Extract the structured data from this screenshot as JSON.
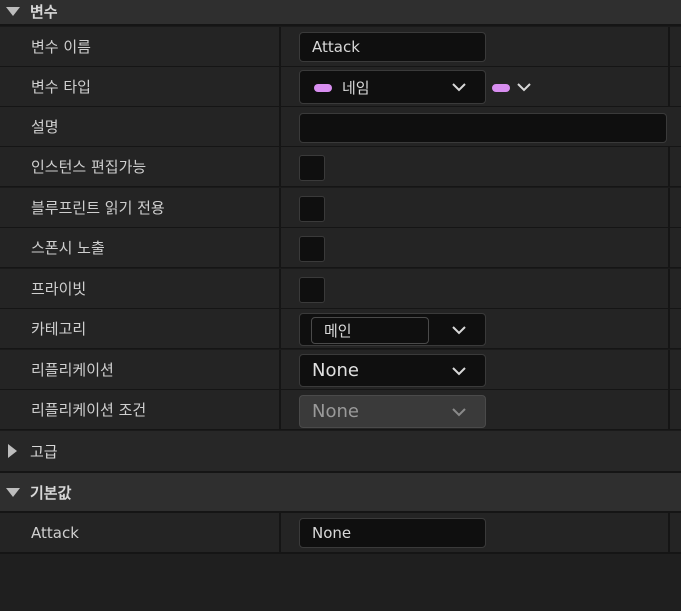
{
  "sections": {
    "variable": {
      "title": "변수"
    },
    "advanced": {
      "title": "고급"
    },
    "default_value": {
      "title": "기본값"
    }
  },
  "rows": {
    "name": {
      "label": "변수 이름",
      "value": "Attack"
    },
    "type": {
      "label": "변수 타입",
      "value": "네임",
      "pin_color": "#d88ef0"
    },
    "description": {
      "label": "설명",
      "value": ""
    },
    "instance_editable": {
      "label": "인스턴스 편집가능",
      "checked": false
    },
    "blueprint_readonly": {
      "label": "블루프린트 읽기 전용",
      "checked": false
    },
    "expose_on_spawn": {
      "label": "스폰시 노출",
      "checked": false
    },
    "private": {
      "label": "프라이빗",
      "checked": false
    },
    "category": {
      "label": "카테고리",
      "value": "메인"
    },
    "replication": {
      "label": "리플리케이션",
      "value": "None"
    },
    "replication_condition": {
      "label": "리플리케이션 조건",
      "value": "None"
    },
    "default_attack": {
      "label": "Attack",
      "value": "None"
    }
  },
  "colors": {
    "panel_bg": "#1a1a1a",
    "row_bg": "#242424",
    "header_bg": "#2f2f2f",
    "pin_name": "#d88ef0"
  }
}
